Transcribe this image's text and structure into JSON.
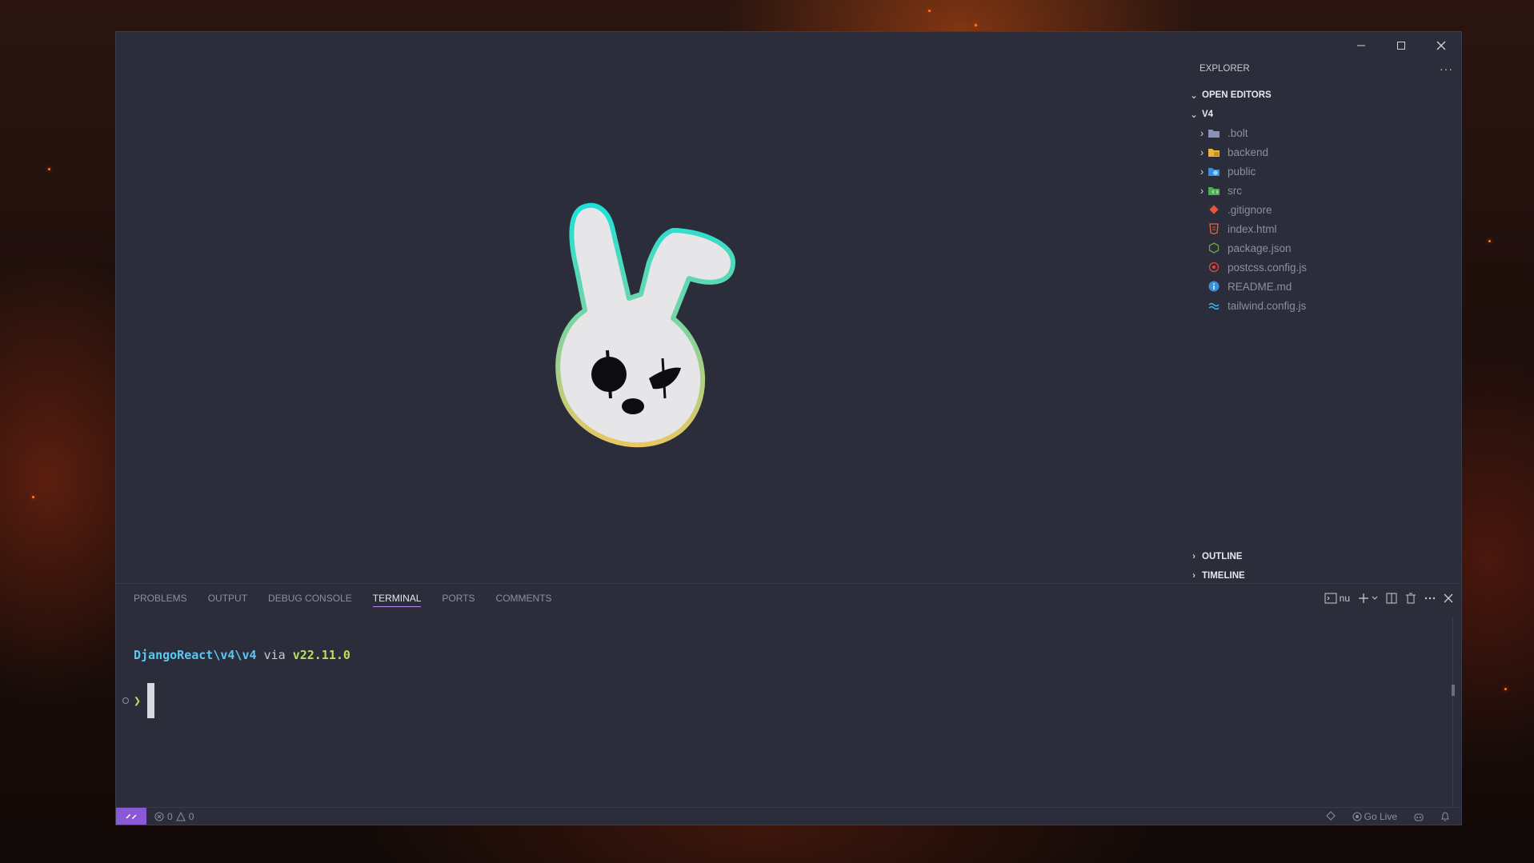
{
  "window": {
    "controls": [
      "minimize",
      "maximize",
      "close"
    ]
  },
  "explorer": {
    "title": "EXPLORER",
    "more": "···",
    "open_editors": "OPEN EDITORS",
    "root": "V4",
    "items": [
      {
        "label": ".bolt",
        "type": "folder",
        "icon": "folder-icon",
        "color": "#8a93b5"
      },
      {
        "label": "backend",
        "type": "folder",
        "icon": "folder-backend-icon",
        "color": "#e8b43a"
      },
      {
        "label": "public",
        "type": "folder",
        "icon": "folder-public-icon",
        "color": "#3a8fd8"
      },
      {
        "label": "src",
        "type": "folder",
        "icon": "folder-src-icon",
        "color": "#4caf50"
      },
      {
        "label": ".gitignore",
        "type": "file",
        "icon": "git-icon",
        "color": "#e8543a"
      },
      {
        "label": "index.html",
        "type": "file",
        "icon": "html-icon",
        "color": "#e8643a"
      },
      {
        "label": "package.json",
        "type": "file",
        "icon": "nodejs-icon",
        "color": "#6aa84f"
      },
      {
        "label": "postcss.config.js",
        "type": "file",
        "icon": "postcss-icon",
        "color": "#e8443a"
      },
      {
        "label": "README.md",
        "type": "file",
        "icon": "info-icon",
        "color": "#3a8fd8"
      },
      {
        "label": "tailwind.config.js",
        "type": "file",
        "icon": "tailwind-icon",
        "color": "#38bdf8"
      }
    ],
    "outline": "OUTLINE",
    "timeline": "TIMELINE"
  },
  "panel": {
    "tabs": [
      {
        "label": "PROBLEMS",
        "active": false
      },
      {
        "label": "OUTPUT",
        "active": false
      },
      {
        "label": "DEBUG CONSOLE",
        "active": false
      },
      {
        "label": "TERMINAL",
        "active": true
      },
      {
        "label": "PORTS",
        "active": false
      },
      {
        "label": "COMMENTS",
        "active": false
      }
    ],
    "shell_name": "nu"
  },
  "terminal": {
    "path": "DjangoReact\\v4\\v4",
    "via": "via",
    "node_icon": "",
    "node_version": "v22.11.0",
    "prompt": "❯"
  },
  "statusbar": {
    "errors": "0",
    "warnings": "0",
    "go_live": "Go Live"
  },
  "colors": {
    "accent": "#8a5ad6",
    "terminal_path": "#5ac8f0",
    "terminal_node": "#b8e05a"
  }
}
